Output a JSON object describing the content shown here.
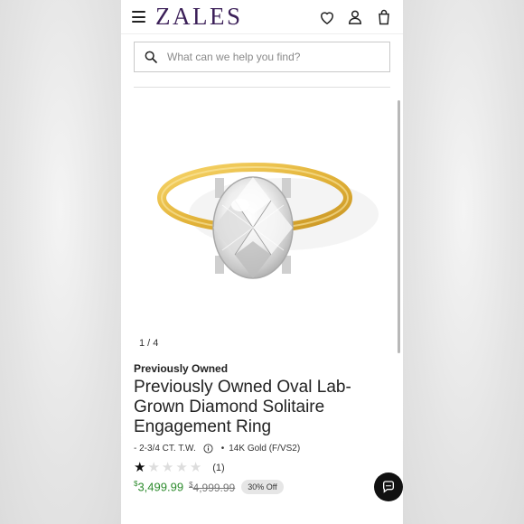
{
  "header": {
    "logo_text": "ZALES",
    "icons": [
      "menu-icon",
      "heart-icon",
      "user-icon",
      "bag-icon"
    ],
    "brand_color": "#3b1f58"
  },
  "search": {
    "placeholder": "What can we help you find?"
  },
  "gallery": {
    "counter": "1 / 4",
    "image": "oval-lab-grown-diamond-solitaire-ring-yellow-gold"
  },
  "product": {
    "condition": "Previously Owned",
    "title": "Previously Owned Oval Lab-Grown Diamond Solitaire Engagement Ring",
    "carat": "- 2-3/4 CT. T.W.",
    "separator": "•",
    "metal": "14K Gold (F/VS2)",
    "rating_value": 1,
    "rating_max": 5,
    "review_count": "(1)",
    "price_currency": "$",
    "price": "3,499.99",
    "original_currency": "$",
    "original_price": "4,999.99",
    "discount_badge": "30% Off",
    "price_color": "#2d8b2d"
  },
  "chat": {
    "icon": "chat-icon"
  }
}
